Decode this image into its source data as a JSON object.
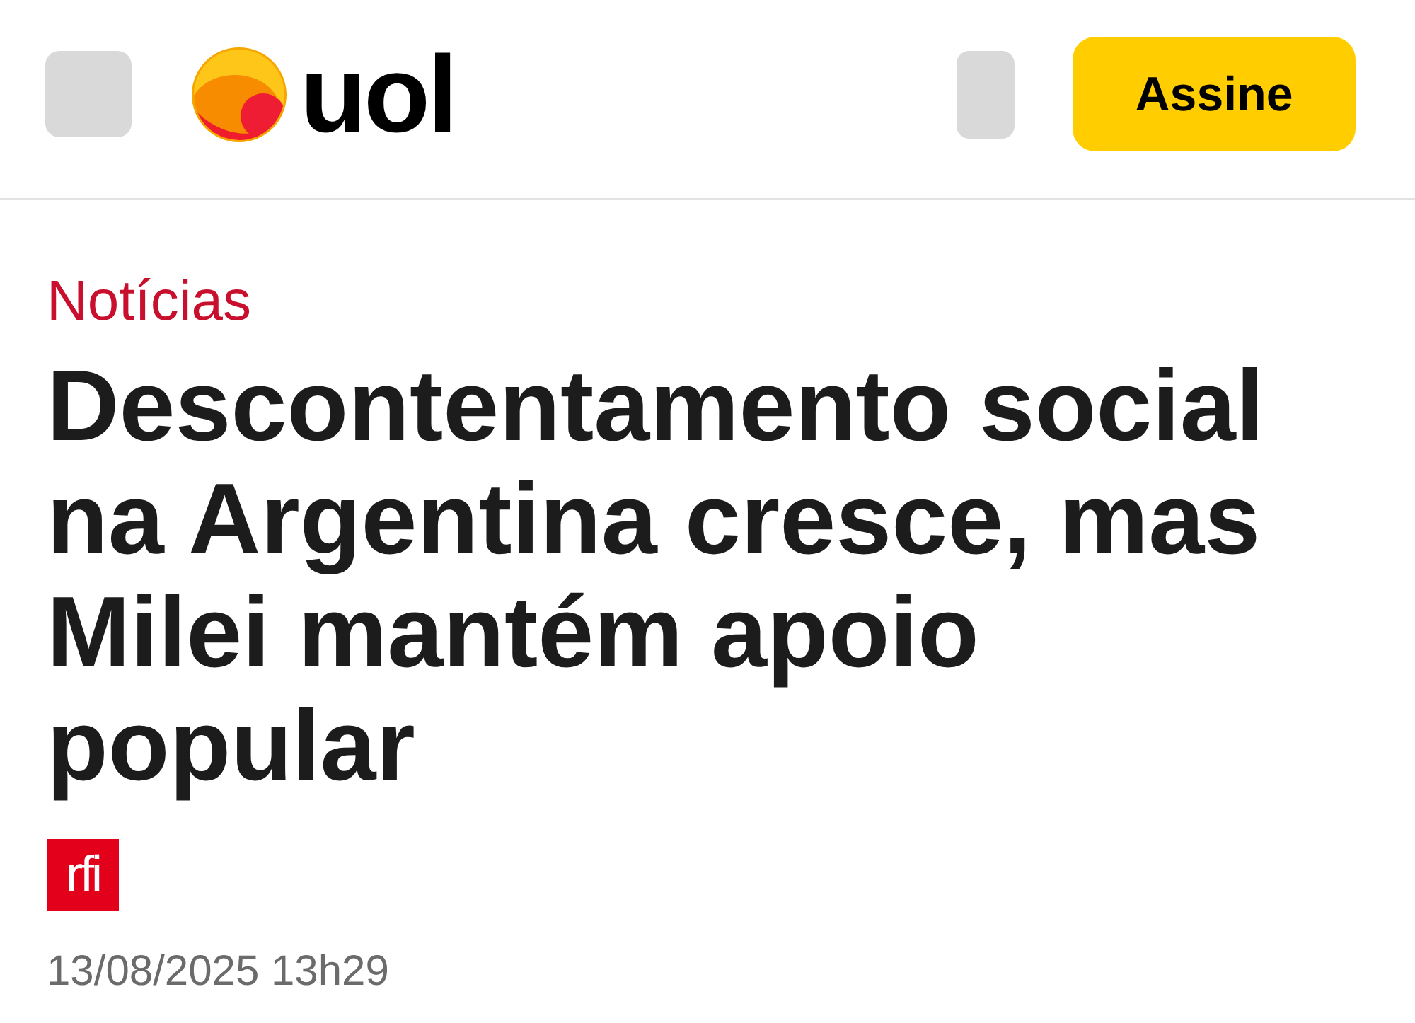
{
  "header": {
    "logo": {
      "wordmark": "uol"
    },
    "subscribe_button": "Assine"
  },
  "article": {
    "category": "Notícias",
    "headline": "Descontentamento social na Argentina cresce, mas Milei mantém apoio popular",
    "source": {
      "logo_text": "rfi"
    },
    "published": "13/08/2025 13h29"
  }
}
